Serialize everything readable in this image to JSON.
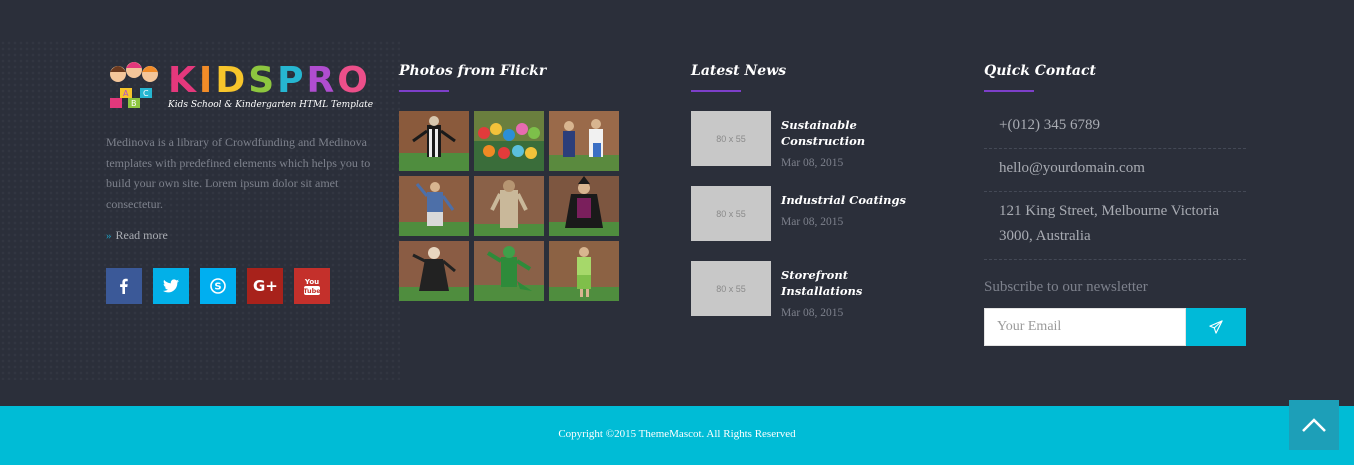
{
  "brand": {
    "logo_letters": [
      "K",
      "I",
      "D",
      "S",
      "P",
      "R",
      "O"
    ],
    "tagline": "Kids School & Kindergarten HTML Template"
  },
  "about": {
    "text": "Medinova is a library of Crowdfunding and Medinova templates with predefined elements which helps you to build your own site. Lorem ipsum dolor sit amet consectetur.",
    "read_more": "Read more"
  },
  "socials": [
    {
      "name": "facebook",
      "glyph": "f",
      "color": "#3b5998"
    },
    {
      "name": "twitter",
      "glyph": "t",
      "color": "#02b0e8"
    },
    {
      "name": "skype",
      "glyph": "S",
      "color": "#00aff0"
    },
    {
      "name": "google-plus",
      "glyph": "G+",
      "color": "#d2412e"
    },
    {
      "name": "youtube",
      "glyph": "You Tube",
      "color": "#c4302b"
    }
  ],
  "flickr": {
    "title": "Photos from Flickr",
    "photos": [
      "photo-1",
      "photo-2",
      "photo-3",
      "photo-4",
      "photo-5",
      "photo-6",
      "photo-7",
      "photo-8",
      "photo-9"
    ]
  },
  "news": {
    "title": "Latest News",
    "items": [
      {
        "thumb": "80 x 55",
        "title": "Sustainable Construction",
        "date": "Mar 08, 2015"
      },
      {
        "thumb": "80 x 55",
        "title": "Industrial Coatings",
        "date": "Mar 08, 2015"
      },
      {
        "thumb": "80 x 55",
        "title": "Storefront Installations",
        "date": "Mar 08, 2015"
      }
    ]
  },
  "contact": {
    "title": "Quick Contact",
    "phone": "+(012) 345 6789",
    "email": "hello@yourdomain.com",
    "address": "121 King Street, Melbourne Victoria 3000, Australia",
    "subscribe_label": "Subscribe to our newsletter",
    "email_placeholder": "Your Email"
  },
  "footer": {
    "copyright": "Copyright ©2015 ThemeMascot. All Rights Reserved"
  },
  "colors": {
    "accent": "#00bcd6",
    "title_underline": "#7d3fc9",
    "footer_bg": "#2b2f3a"
  }
}
